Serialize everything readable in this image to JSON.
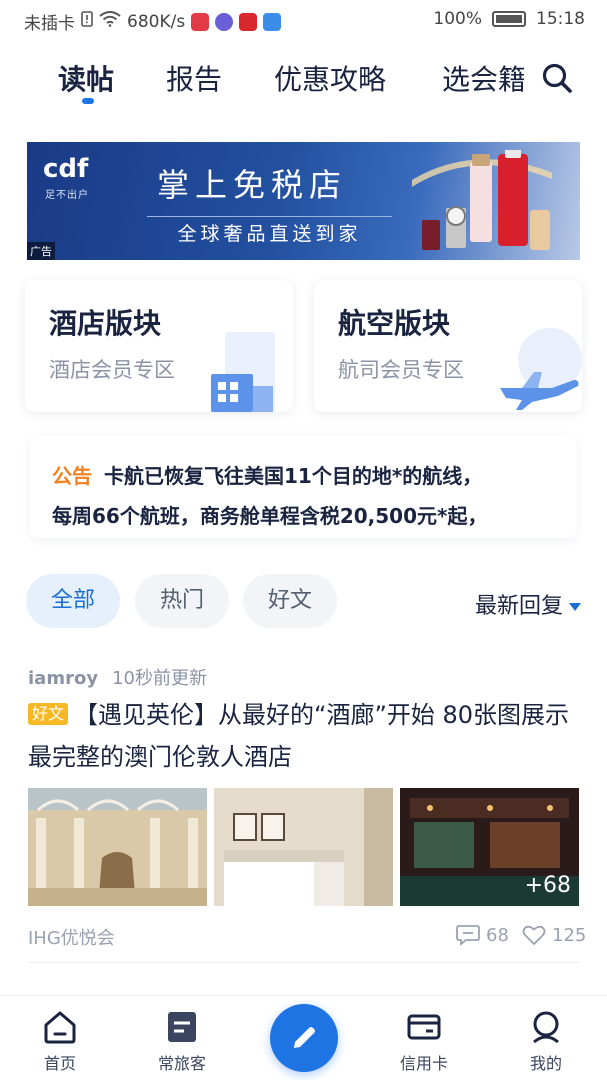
{
  "status_bar": {
    "carrier": "未插卡",
    "speed": "680K/s",
    "battery": "100%",
    "time": "15:18"
  },
  "tabs": [
    {
      "label": "读帖",
      "active": true
    },
    {
      "label": "报告",
      "active": false
    },
    {
      "label": "优惠攻略",
      "active": false
    },
    {
      "label": "选会籍",
      "active": false
    }
  ],
  "banner": {
    "logo": "cdf",
    "logo_sub": "足不出户",
    "title": "掌上免税店",
    "subtitle": "全球奢品直送到家",
    "ad_tag": "广告"
  },
  "sections": [
    {
      "title": "酒店版块",
      "subtitle": "酒店会员专区"
    },
    {
      "title": "航空版块",
      "subtitle": "航司会员专区"
    }
  ],
  "notice": {
    "label": "公告",
    "line1": "卡航已恢复飞往美国11个目的地*的航线，",
    "line2": "每周66个航班，商务舱单程含税20,500元*起，"
  },
  "filters": {
    "chips": [
      {
        "label": "全部",
        "active": true
      },
      {
        "label": "热门",
        "active": false
      },
      {
        "label": "好文",
        "active": false
      }
    ],
    "sort_label": "最新回复"
  },
  "post": {
    "author": "iamroy",
    "time": "10秒前更新",
    "badge": "好文",
    "title": "【遇见英伦】从最好的“酒廊”开始 80张图展示最完整的澳门伦敦人酒店",
    "more_images": "+68",
    "source": "IHG优悦会",
    "comments": "68",
    "likes": "125"
  },
  "bottom_nav": {
    "home": "首页",
    "traveler": "常旅客",
    "credit_card": "信用卡",
    "mine": "我的"
  },
  "colors": {
    "accent": "#1f74e4",
    "notice_label": "#f08020",
    "badge": "#f6b824",
    "text": "#1a2440"
  }
}
